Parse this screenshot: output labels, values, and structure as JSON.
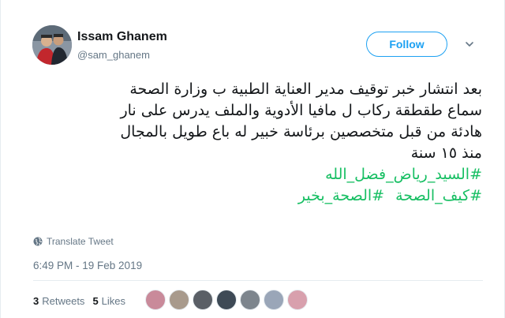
{
  "author": {
    "name": "Issam Ghanem",
    "handle": "@sam_ghanem"
  },
  "follow_button_label": "Follow",
  "tweet": {
    "lines": [
      "بعد انتشار خبر توقيف مدير العناية الطبية ب وزارة الصحة",
      "سماع طقطقة ركاب ل مافيا الأدوية والملف يدرس على نار",
      "هادئة من قبل متخصصين برئاسة خبير له باع طويل بالمجال",
      "منذ ١٥ سنة"
    ],
    "hashtags_line1": [
      "#السيد_رياض_فضل_الله"
    ],
    "hashtags_line2": [
      "#كيف_الصحة",
      "#الصحة_بخير"
    ]
  },
  "translate_label": "Translate Tweet",
  "timestamp": "6:49 PM - 19 Feb 2019",
  "stats": {
    "retweets_count": "3",
    "retweets_label": "Retweets",
    "likes_count": "5",
    "likes_label": "Likes"
  },
  "colors": {
    "accent": "#1da1f2",
    "hashtag": "#17bf63",
    "secondary_text": "#657786",
    "border": "#e6ecf0"
  },
  "icons": [
    "chevron-down-icon",
    "globe-icon"
  ],
  "likers": [
    {
      "avatar_color": "#c98a9a"
    },
    {
      "avatar_color": "#a89a8c"
    },
    {
      "avatar_color": "#5a5f66"
    },
    {
      "avatar_color": "#3e4a56"
    },
    {
      "avatar_color": "#7d858d"
    },
    {
      "avatar_color": "#9aa6b8"
    },
    {
      "avatar_color": "#d8a0ad"
    }
  ]
}
